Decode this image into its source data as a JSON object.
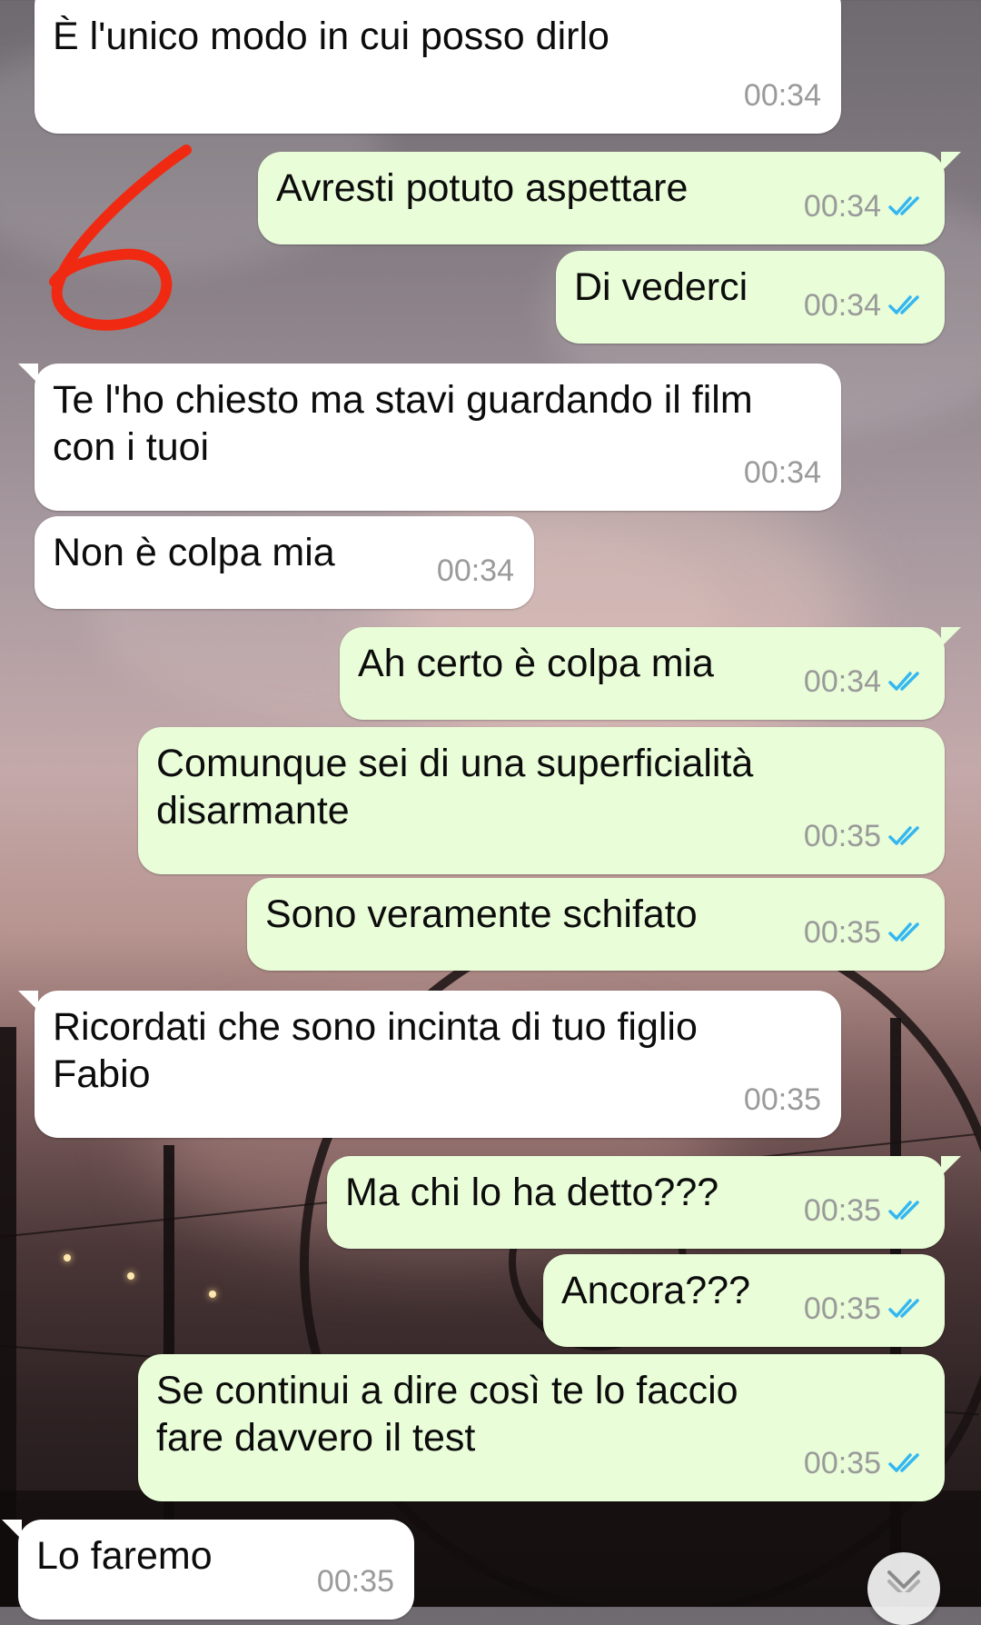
{
  "chat": {
    "messages": [
      {
        "dir": "in",
        "text": "È l'unico modo in cui posso dirlo",
        "time": "00:34"
      },
      {
        "dir": "out",
        "text": "Avresti potuto aspettare",
        "time": "00:34",
        "status": "read"
      },
      {
        "dir": "out",
        "text": "Di vederci",
        "time": "00:34",
        "status": "read"
      },
      {
        "dir": "in",
        "text": "Te l'ho chiesto ma stavi guardando il film con i tuoi",
        "time": "00:34"
      },
      {
        "dir": "in",
        "text": "Non è colpa mia",
        "time": "00:34"
      },
      {
        "dir": "out",
        "text": "Ah certo è colpa mia",
        "time": "00:34",
        "status": "read"
      },
      {
        "dir": "out",
        "text": "Comunque sei di una superficialità disarmante",
        "time": "00:35",
        "status": "read"
      },
      {
        "dir": "out",
        "text": "Sono veramente schifato",
        "time": "00:35",
        "status": "read"
      },
      {
        "dir": "in",
        "text": "Ricordati che sono incinta di tuo figlio Fabio",
        "time": "00:35"
      },
      {
        "dir": "out",
        "text": "Ma chi lo ha detto???",
        "time": "00:35",
        "status": "read"
      },
      {
        "dir": "out",
        "text": "Ancora???",
        "time": "00:35",
        "status": "read"
      },
      {
        "dir": "out",
        "text": "Se continui a dire così te lo faccio fare davvero il test",
        "time": "00:35",
        "status": "read"
      },
      {
        "dir": "in",
        "text": "Lo faremo",
        "time": "00:35"
      }
    ]
  },
  "annotation": {
    "text": "6",
    "color": "#f02a12"
  },
  "colors": {
    "incoming_bubble": "#ffffff",
    "outgoing_bubble": "#e9fdd8",
    "read_tick": "#34b7f1",
    "timestamp": "#9a9a9a"
  },
  "icons": {
    "read_status": "double-check-icon",
    "scroll": "chevron-down-icon"
  }
}
